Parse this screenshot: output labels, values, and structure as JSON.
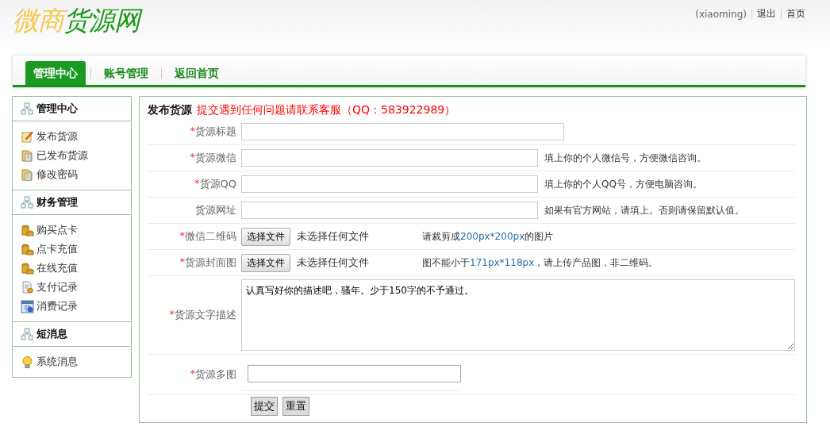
{
  "logo": {
    "part_1": "微商",
    "part_2": "货源网"
  },
  "user_links": [
    {
      "text": "(xiaoming)",
      "kind": "user"
    },
    {
      "text": "退出",
      "kind": "link"
    },
    {
      "text": "首页",
      "kind": "link"
    }
  ],
  "nav": [
    {
      "label": "管理中心",
      "selected": true
    },
    {
      "label": "账号管理",
      "selected": false
    },
    {
      "label": "返回首页",
      "selected": false
    }
  ],
  "sidebar": [
    {
      "title": "管理中心",
      "items": [
        {
          "label": "发布货源",
          "kind": "note"
        },
        {
          "label": "已发布货源",
          "kind": "folder"
        },
        {
          "label": "修改密码",
          "kind": "folder"
        }
      ]
    },
    {
      "title": "财务管理",
      "items": [
        {
          "label": "购买点卡",
          "kind": "coins"
        },
        {
          "label": "点卡充值",
          "kind": "coins"
        },
        {
          "label": "在线充值",
          "kind": "coins"
        },
        {
          "label": "支付记录",
          "kind": "receipt"
        },
        {
          "label": "消费记录",
          "kind": "calendar"
        }
      ]
    },
    {
      "title": "短消息",
      "items": [
        {
          "label": "系统消息",
          "kind": "bulb"
        }
      ]
    }
  ],
  "form": {
    "title": "发布货源",
    "notice": "提交遇到任何问题请联系客服（QQ：583922989）",
    "rows": [
      {
        "mark": "*",
        "label": "货源标题",
        "kind": "text"
      },
      {
        "mark": "*",
        "label": "货源微信",
        "kind": "text",
        "hint": [
          {
            "text": "填上你的个人微信号，方便微信咨询。",
            "highlight": false
          }
        ]
      },
      {
        "mark": "*",
        "label": "货源QQ",
        "kind": "text",
        "hint": [
          {
            "text": "填上你的个人QQ号，方便电脑咨询。",
            "highlight": false
          }
        ]
      },
      {
        "label": "货源网址",
        "kind": "text",
        "hint": [
          {
            "text": "如果有官方网站，请填上。否则请保留默认值。",
            "highlight": false
          }
        ]
      },
      {
        "mark": "*",
        "label": "微信二维码",
        "kind": "file",
        "button": "选择文件",
        "status": "未选择任何文件",
        "hint": [
          {
            "text": "请裁剪成",
            "highlight": false
          },
          {
            "text": "200px*200px",
            "highlight": true
          },
          {
            "text": "的图片",
            "highlight": false
          }
        ]
      },
      {
        "mark": "*",
        "label": "货源封面图",
        "kind": "file",
        "button": "选择文件",
        "status": "未选择任何文件",
        "hint": [
          {
            "text": "图不能小于",
            "highlight": false
          },
          {
            "text": "171px*118px",
            "highlight": true
          },
          {
            "text": "，请上传产品图，非二维码。",
            "highlight": false
          }
        ]
      },
      {
        "mark": "*",
        "label": "货源文字描述",
        "kind": "textarea",
        "value": "认真写好你的描述吧，骚年。少于150字的不予通过。"
      },
      {
        "mark": "*",
        "label": "货源多图",
        "kind": "multi"
      }
    ],
    "buttons": [
      "提交",
      "重置"
    ]
  }
}
